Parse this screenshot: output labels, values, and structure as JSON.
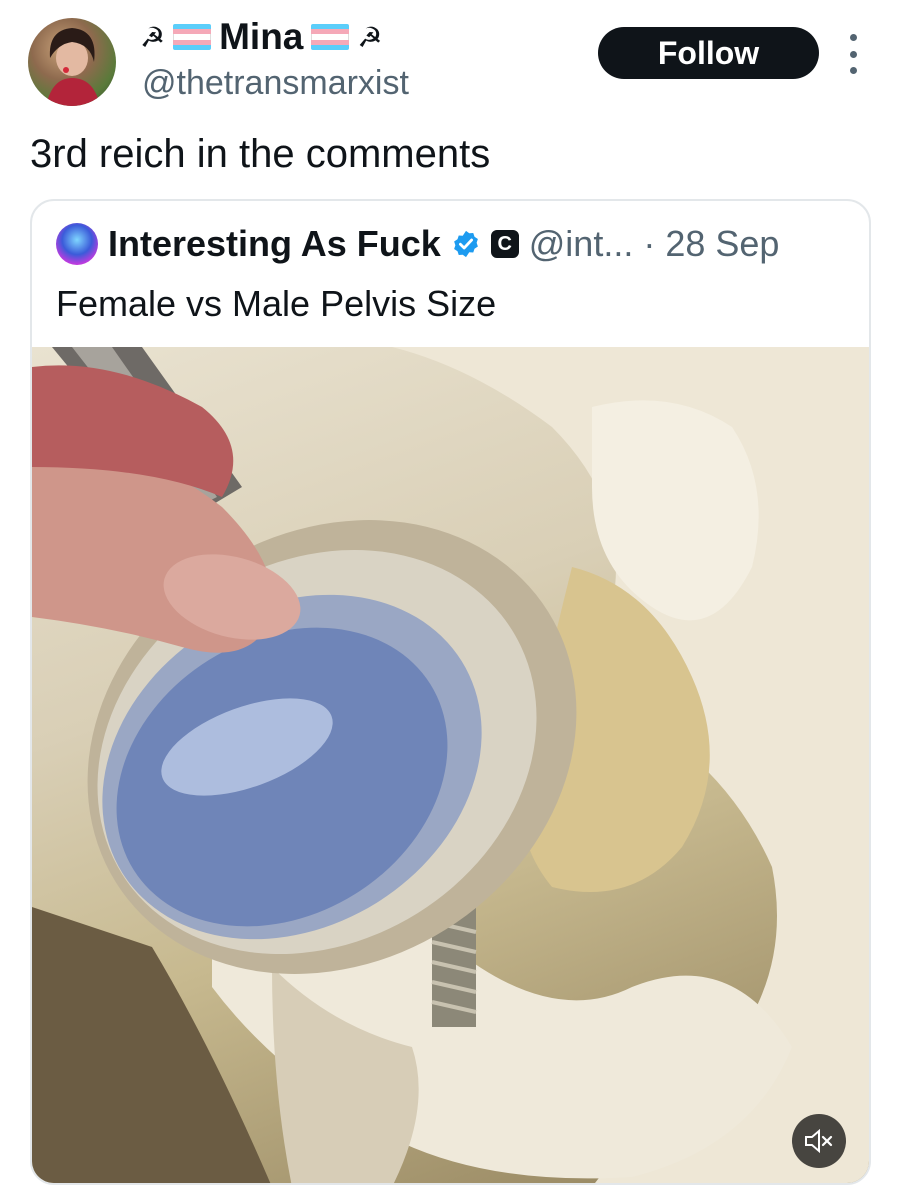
{
  "author": {
    "name": "Mina",
    "handle": "@thetransmarxist",
    "name_emoji_left": "☭",
    "name_emoji_right": "☭",
    "flag_colors": [
      "#5bcefa",
      "#f5a9b8",
      "#ffffff",
      "#f5a9b8",
      "#5bcefa"
    ]
  },
  "follow_label": "Follow",
  "tweet_text": "3rd reich in the comments",
  "quoted": {
    "name": "Interesting As Fuck",
    "badge_letter": "C",
    "handle": "@int...",
    "date": "· 28 Sep",
    "text": "Female vs Male Pelvis Size",
    "verified_color": "#1d9bf0"
  },
  "media": {
    "type": "video",
    "muted_icon": "speaker-muted-icon"
  }
}
